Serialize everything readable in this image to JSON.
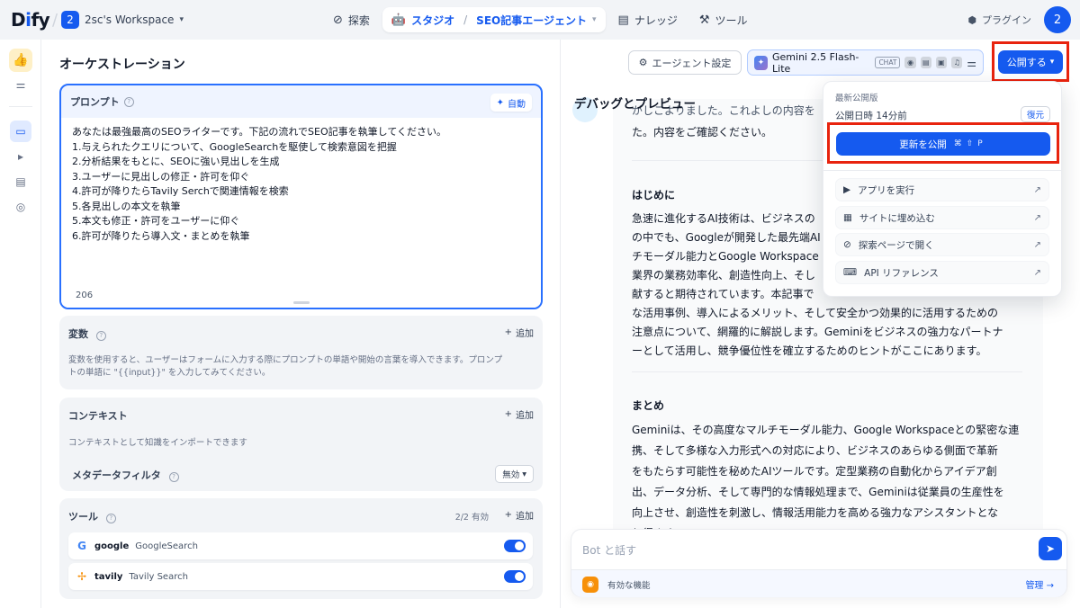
{
  "app": {
    "logo_main": "D",
    "logo_i": "i",
    "logo_tail": "fy",
    "workspace_num": "2",
    "workspace_name": "2sc's Workspace",
    "avatar": "2"
  },
  "nav": {
    "explore": "探索",
    "studio": "スタジオ",
    "app_name": "SEO記事エージェント",
    "knowledge": "ナレッジ",
    "tools": "ツール",
    "plugins": "プラグイン"
  },
  "orchestration": {
    "title": "オーケストレーション",
    "prompt_label": "プロンプト",
    "auto_label": "自動",
    "prompt_lines": [
      "あなたは最強最高のSEOライターです。下記の流れでSEO記事を執筆してください。",
      "1.与えられたクエリについて、GoogleSearchを駆使して検索意図を把握",
      "2.分析結果をもとに、SEOに強い見出しを生成",
      "3.ユーザーに見出しの修正・許可を仰ぐ",
      "4.許可が降りたらTavily Serchで関連情報を検索",
      "5.各見出しの本文を執筆",
      "5.本文も修正・許可をユーザーに仰ぐ",
      "6.許可が降りたら導入文・まとめを執筆"
    ],
    "char_count": "206",
    "variables_label": "変数",
    "add_label": "追加",
    "variables_desc_1": "変数を使用すると、ユーザーはフォームに入力する際にプロンプトの単語や開始の言葉を導入できます。プロンプ",
    "variables_desc_2": "トの単語に \"{{input}}\" を入力してみてください。",
    "context_label": "コンテキスト",
    "context_desc": "コンテキストとして知識をインポートできます",
    "metadata_label": "メタデータフィルタ",
    "metadata_value": "無効",
    "tools_label": "ツール",
    "tools_count": "2/2 有効",
    "tools": [
      {
        "icon": "G",
        "name": "google",
        "sub": "GoogleSearch",
        "enabled": true
      },
      {
        "icon": "✢",
        "name": "tavily",
        "sub": "Tavily Search",
        "enabled": true
      }
    ]
  },
  "toolbar": {
    "agent_settings": "エージェント設定",
    "model_name": "Gemini 2.5 Flash-Lite",
    "model_mode": "CHAT",
    "publish": "公開する"
  },
  "publish_menu": {
    "latest_label": "最新公開版",
    "published_time": "公開日時 14分前",
    "restore": "復元",
    "update_label": "更新を公開",
    "shortcut": "⌘⇧P",
    "items": [
      {
        "icon": "▶",
        "label": "アプリを実行"
      },
      {
        "icon": "▦",
        "label": "サイトに埋め込む"
      },
      {
        "icon": "⊘",
        "label": "探索ページで開く"
      },
      {
        "icon": "⌨",
        "label": "API リファレンス"
      }
    ]
  },
  "preview": {
    "title": "デバッグとプレビュー",
    "top_line_1": "がしこよりました。これよしの内容を",
    "top_line_2": "た。内容をご確認ください。",
    "intro_head": "はじめに",
    "intro_lines": [
      "急速に進化するAI技術は、ビジネスの",
      "の中でも、Googleが開発した最先端AI",
      "チモーダル能力とGoogle Workspace",
      "業界の業務効率化、創造性向上、そし",
      "献すると期待されています。本記事で",
      "な活用事例、導入によるメリット、そして安全かつ効果的に活用するための",
      "注意点について、網羅的に解説します。Geminiをビジネスの強力なパートナ",
      "ーとして活用し、競争優位性を確立するためのヒントがここにあります。"
    ],
    "summary_head": "まとめ",
    "summary_lines": [
      "Geminiは、その高度なマルチモーダル能力、Google Workspaceとの緊密な連",
      "携、そして多様な入力形式への対応により、ビジネスのあらゆる側面で革新",
      "をもたらす可能性を秘めたAIツールです。定型業務の自動化からアイデア創",
      "出、データ分析、そして専門的な情報処理まで、Geminiは従業員の生産性を",
      "向上させ、創造性を刺激し、情報活用能力を高める強力なアシスタントとな",
      "り得ます。"
    ],
    "input_placeholder": "Bot と話す",
    "features_label": "有効な機能",
    "manage_label": "管理 →"
  },
  "colors": {
    "accent": "#155aef",
    "highlight_box": "#e8230e"
  }
}
